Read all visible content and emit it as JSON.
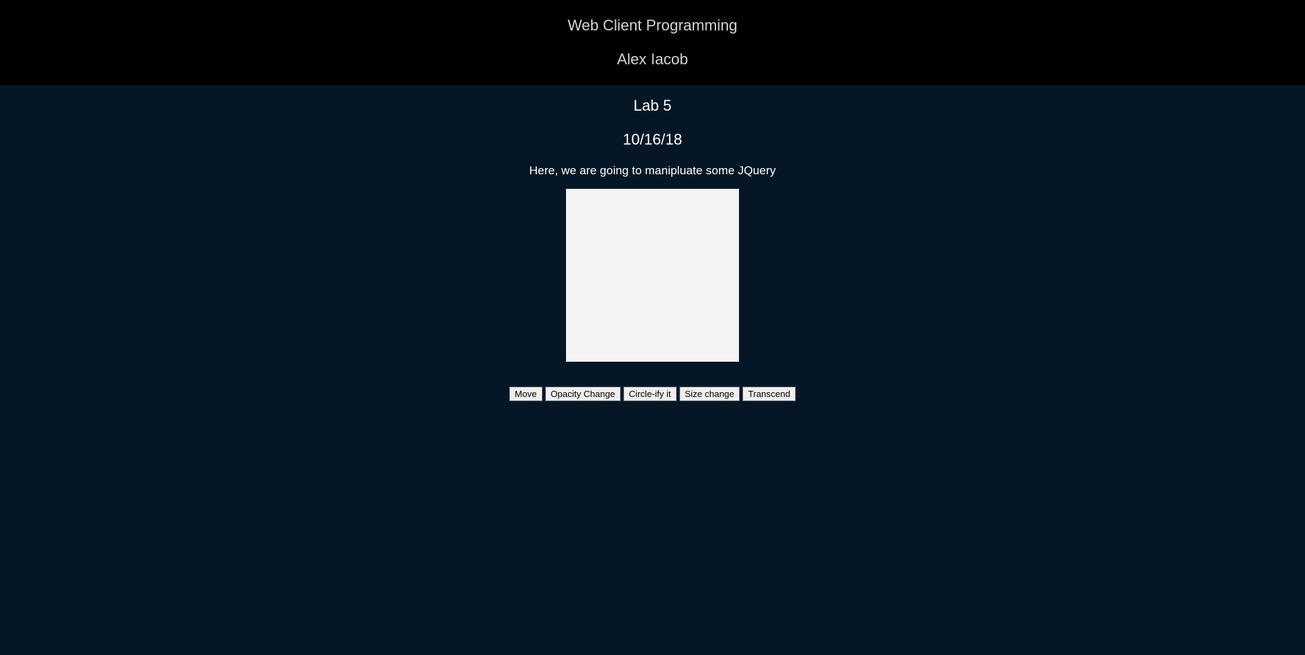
{
  "header": {
    "course": "Web Client Programming",
    "author": "Alex Iacob"
  },
  "main": {
    "lab": "Lab 5",
    "date": "10/16/18",
    "description": "Here, we are going to manipluate some JQuery"
  },
  "box": {
    "color": "#f3f3f3"
  },
  "buttons": {
    "move": "Move",
    "opacity": "Opacity Change",
    "circle": "Circle-ify it",
    "size": "Size change",
    "transcend": "Transcend"
  },
  "colors": {
    "header_bg": "#000000",
    "page_bg": "#051727",
    "header_text": "#d4d4d4",
    "body_text": "#ffffff"
  }
}
